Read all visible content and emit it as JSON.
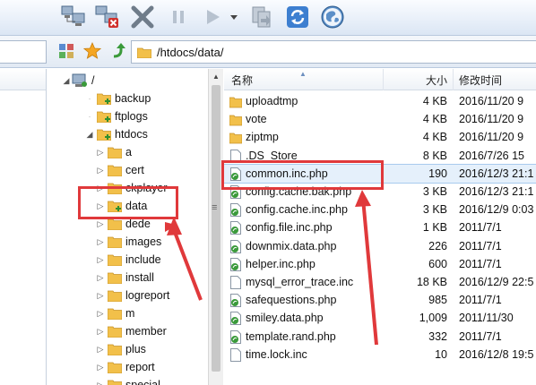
{
  "toolbar": {
    "buttons": [
      {
        "name": "connect-icon"
      },
      {
        "name": "disconnect-icon"
      },
      {
        "name": "cancel-icon"
      },
      {
        "name": "pause-icon"
      },
      {
        "name": "play-icon"
      },
      {
        "name": "dropdown-arrow-icon"
      },
      {
        "name": "transfer-icon"
      },
      {
        "name": "refresh-icon"
      },
      {
        "name": "globe-icon"
      }
    ]
  },
  "pathbar": {
    "path": "/htdocs/data/"
  },
  "tree": {
    "root": "/",
    "items": [
      {
        "label": "backup",
        "depth": 1,
        "arrow": ""
      },
      {
        "label": "ftplogs",
        "depth": 1,
        "arrow": ""
      },
      {
        "label": "htdocs",
        "depth": 1,
        "arrow": "◢"
      },
      {
        "label": "a",
        "depth": 2,
        "arrow": "▷"
      },
      {
        "label": "cert",
        "depth": 2,
        "arrow": "▷"
      },
      {
        "label": "ckplayer",
        "depth": 2,
        "arrow": "▷"
      },
      {
        "label": "data",
        "depth": 2,
        "arrow": "▷"
      },
      {
        "label": "dede",
        "depth": 2,
        "arrow": "▷"
      },
      {
        "label": "images",
        "depth": 2,
        "arrow": "▷"
      },
      {
        "label": "include",
        "depth": 2,
        "arrow": "▷"
      },
      {
        "label": "install",
        "depth": 2,
        "arrow": "▷"
      },
      {
        "label": "logreport",
        "depth": 2,
        "arrow": "▷"
      },
      {
        "label": "m",
        "depth": 2,
        "arrow": "▷"
      },
      {
        "label": "member",
        "depth": 2,
        "arrow": "▷"
      },
      {
        "label": "plus",
        "depth": 2,
        "arrow": "▷"
      },
      {
        "label": "report",
        "depth": 2,
        "arrow": "▷"
      },
      {
        "label": "special",
        "depth": 2,
        "arrow": "▷"
      }
    ]
  },
  "list": {
    "headers": {
      "name": "名称",
      "size": "大小",
      "modified": "修改时间"
    },
    "rows": [
      {
        "name": "uploadtmp",
        "size": "4 KB",
        "date": "2016/11/20 9",
        "type": "folder"
      },
      {
        "name": "vote",
        "size": "4 KB",
        "date": "2016/11/20 9",
        "type": "folder"
      },
      {
        "name": "ziptmp",
        "size": "4 KB",
        "date": "2016/11/20 9",
        "type": "folder"
      },
      {
        "name": ".DS_Store",
        "size": "8 KB",
        "date": "2016/7/26 15",
        "type": "file"
      },
      {
        "name": "common.inc.php",
        "size": "190",
        "date": "2016/12/3 21:1",
        "type": "php",
        "selected": true
      },
      {
        "name": "config.cache.bak.php",
        "size": "3 KB",
        "date": "2016/12/3 21:1",
        "type": "php"
      },
      {
        "name": "config.cache.inc.php",
        "size": "3 KB",
        "date": "2016/12/9 0:03",
        "type": "php"
      },
      {
        "name": "config.file.inc.php",
        "size": "1 KB",
        "date": "2011/7/1",
        "type": "php"
      },
      {
        "name": "downmix.data.php",
        "size": "226",
        "date": "2011/7/1",
        "type": "php"
      },
      {
        "name": "helper.inc.php",
        "size": "600",
        "date": "2011/7/1",
        "type": "php"
      },
      {
        "name": "mysql_error_trace.inc",
        "size": "18 KB",
        "date": "2016/12/9 22:5",
        "type": "file"
      },
      {
        "name": "safequestions.php",
        "size": "985",
        "date": "2011/7/1",
        "type": "php"
      },
      {
        "name": "smiley.data.php",
        "size": "1,009",
        "date": "2011/11/30",
        "type": "php"
      },
      {
        "name": "template.rand.php",
        "size": "332",
        "date": "2011/7/1",
        "type": "php"
      },
      {
        "name": "time.lock.inc",
        "size": "10",
        "date": "2016/12/8 19:5",
        "type": "file"
      }
    ]
  },
  "colors": {
    "annotation": "#e0393b",
    "folder": "#f2c04a",
    "php": "#3a9a3a"
  }
}
